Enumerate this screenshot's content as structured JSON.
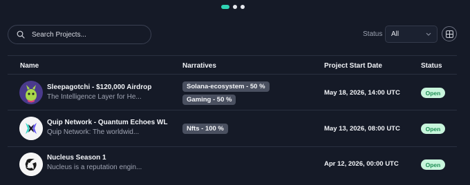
{
  "pagination": {
    "count": 3,
    "active_index": 0
  },
  "search": {
    "placeholder": "Search Projects..."
  },
  "filter": {
    "label": "Status",
    "value": "All"
  },
  "table": {
    "columns": [
      "Name",
      "Narratives",
      "Project Start Date",
      "Status"
    ],
    "rows": [
      {
        "name": "Sleepagotchi - $120,000 Airdrop",
        "description": "The Intelligence Layer for He...",
        "narratives": [
          "Solana-ecosystem - 50 %",
          "Gaming - 50 %"
        ],
        "start_date": "May 18, 2026, 14:00 UTC",
        "status": "Open"
      },
      {
        "name": "Quip Network - Quantum Echoes WL",
        "description": "Quip Network: The worldwid...",
        "narratives": [
          "Nfts - 100 %"
        ],
        "start_date": "May 13, 2026, 08:00 UTC",
        "status": "Open"
      },
      {
        "name": "Nucleus Season 1",
        "description": "Nucleus is a reputation engin...",
        "narratives": [],
        "start_date": "Apr 12, 2026, 00:00 UTC",
        "status": "Open"
      }
    ]
  },
  "colors": {
    "background": "#151a27",
    "accent": "#2fd3b4",
    "status_open_bg": "#c8f5dc",
    "status_open_text": "#1f8f55"
  },
  "icons": {
    "search": "search-icon",
    "status_dropdown": "chevron-down-icon",
    "view_toggle": "grid-view-icon"
  }
}
